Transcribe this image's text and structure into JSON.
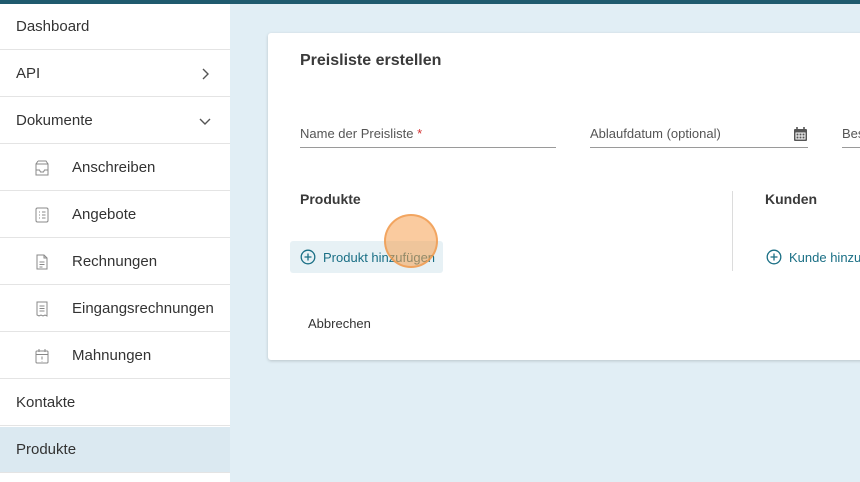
{
  "sidebar": {
    "items": [
      {
        "label": "Dashboard"
      },
      {
        "label": "API"
      },
      {
        "label": "Dokumente"
      },
      {
        "label": "Anschreiben"
      },
      {
        "label": "Angebote"
      },
      {
        "label": "Rechnungen"
      },
      {
        "label": "Eingangsrechnungen"
      },
      {
        "label": "Mahnungen"
      },
      {
        "label": "Kontakte"
      },
      {
        "label": "Produkte"
      }
    ],
    "active_item": "Produkte"
  },
  "form": {
    "title": "Preisliste erstellen",
    "name_label": "Name der Preisliste",
    "required_mark": "*",
    "expiry_label": "Ablaufdatum (optional)",
    "third_label": "Bes",
    "products_title": "Produkte",
    "customers_title": "Kunden",
    "add_product_label": "Produkt hinzufügen",
    "add_customer_label": "Kunde hinzuf",
    "cancel_label": "Abbrechen"
  },
  "colors": {
    "accent": "#1a6f85",
    "topbar": "#1f5a6e",
    "background": "#e1eef5",
    "active_nav": "#dbe9f1",
    "required": "#d32f2f",
    "click_indicator": "#f6a050"
  }
}
